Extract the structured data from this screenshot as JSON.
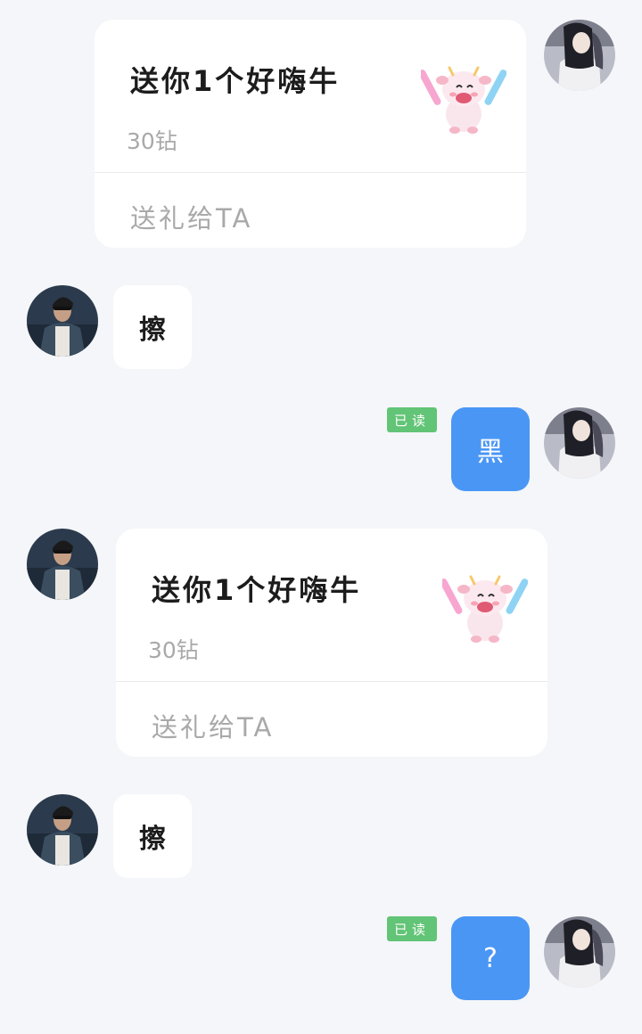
{
  "messages": {
    "gift_1": {
      "title": "送你1个好嗨牛",
      "price": "30钻",
      "action": "送礼给TA",
      "image": "cow-gift-icon"
    },
    "in_1": {
      "text": "擦"
    },
    "out_1": {
      "text": "黑",
      "status": "已读"
    },
    "gift_2": {
      "title": "送你1个好嗨牛",
      "price": "30钻",
      "action": "送礼给TA",
      "image": "cow-gift-icon"
    },
    "in_2": {
      "text": "擦"
    },
    "out_2": {
      "text": "?",
      "status": "已读"
    }
  },
  "colors": {
    "background": "#f4f6f9",
    "bubble_out": "#4a96f5",
    "read_badge": "#62c476"
  }
}
